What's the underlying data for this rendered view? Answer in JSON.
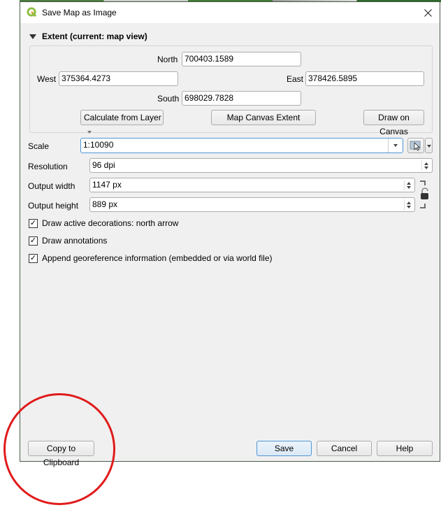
{
  "window": {
    "title": "Save Map as Image",
    "app_icon": "qgis-logo-icon",
    "close_icon": "close-icon"
  },
  "extent": {
    "header": "Extent (current: map view)",
    "north_label": "North",
    "north_value": "700403.1589",
    "west_label": "West",
    "west_value": "375364.4273",
    "east_label": "East",
    "east_value": "378426.5895",
    "south_label": "South",
    "south_value": "698029.7828",
    "calculate_from_layer": "Calculate from Layer",
    "map_canvas_extent": "Map Canvas Extent",
    "draw_on_canvas": "Draw on Canvas"
  },
  "settings": {
    "scale_label": "Scale",
    "scale_value": "1:10090",
    "resolution_label": "Resolution",
    "resolution_value": "96 dpi",
    "output_width_label": "Output width",
    "output_width_value": "1147 px",
    "output_height_label": "Output height",
    "output_height_value": "889 px"
  },
  "checkboxes": [
    {
      "label": "Draw active decorations: north arrow",
      "checked": true
    },
    {
      "label": "Draw annotations",
      "checked": true
    },
    {
      "label": "Append georeference information (embedded or via world file)",
      "checked": true
    }
  ],
  "footer": {
    "copy_to_clipboard": "Copy to Clipboard",
    "save": "Save",
    "cancel": "Cancel",
    "help": "Help"
  },
  "annotation": {
    "highlight_color": "#e01b1b"
  }
}
